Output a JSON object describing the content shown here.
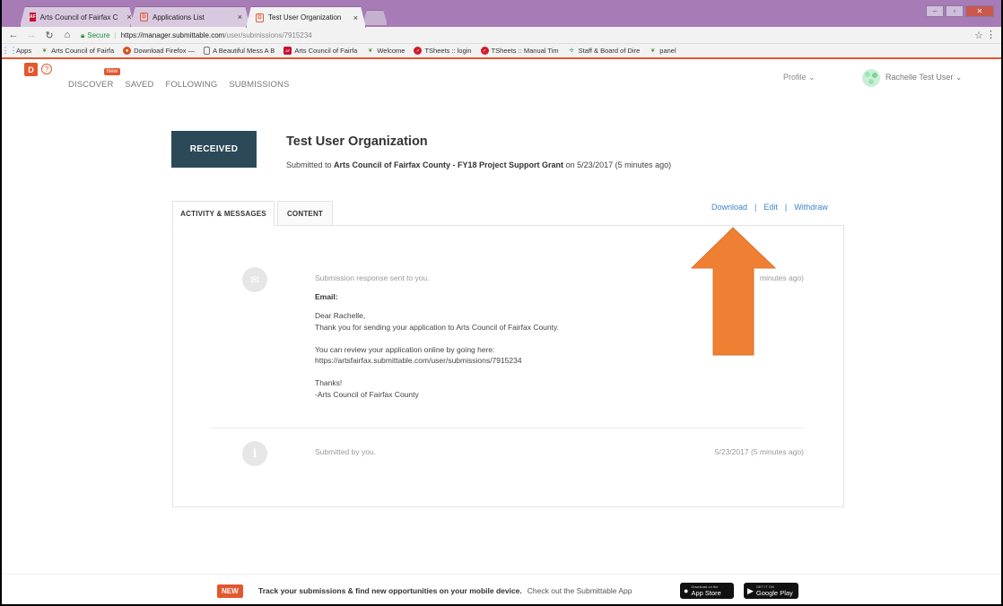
{
  "browser": {
    "tabs": [
      {
        "label": "Arts Council of Fairfax C",
        "icon": "acf-favicon",
        "close": "×"
      },
      {
        "label": "Applications List",
        "icon": "submittable-favicon",
        "close": "×"
      },
      {
        "label": "Test User Organization",
        "icon": "submittable-favicon",
        "close": "×",
        "active": true
      }
    ],
    "address": {
      "secure_label": "Secure",
      "url_host": "https://manager.submittable.com",
      "url_path": "/user/submissions/7915234"
    },
    "bookmarks": [
      {
        "label": "Apps",
        "icon": "apps-grid-icon"
      },
      {
        "label": "Arts Council of Fairfa",
        "icon": "leaf-icon"
      },
      {
        "label": "Download Firefox —",
        "icon": "firefox-icon"
      },
      {
        "label": "A Beautiful Mess A B",
        "icon": "document-icon"
      },
      {
        "label": "Arts Council of Fairfa",
        "icon": "acf-icon"
      },
      {
        "label": "Welcome",
        "icon": "leaf-icon"
      },
      {
        "label": "TSheets :: login",
        "icon": "tsheets-icon"
      },
      {
        "label": "TSheets :: Manual Tim",
        "icon": "tsheets-icon"
      },
      {
        "label": "Staff & Board of Dire",
        "icon": "staff-icon"
      },
      {
        "label": "panel",
        "icon": "leaf-icon"
      }
    ]
  },
  "header": {
    "nav": [
      "DISCOVER",
      "SAVED",
      "FOLLOWING",
      "SUBMISSIONS"
    ],
    "new_badge": "New",
    "profile_label": "Profile ⌄",
    "user_label": "Rachelle Test User ⌄"
  },
  "submission": {
    "status": "RECEIVED",
    "title": "Test User Organization",
    "submitted_prefix": "Submitted to ",
    "submitted_target": "Arts Council of Fairfax County - FY18 Project Support Grant",
    "submitted_suffix": " on 5/23/2017 (5 minutes ago)"
  },
  "tabs": {
    "activity": "ACTIVITY & MESSAGES",
    "content": "CONTENT"
  },
  "actions": {
    "download": "Download",
    "edit": "Edit",
    "withdraw": "Withdraw",
    "separator": "|"
  },
  "feed": [
    {
      "icon": "envelope-icon",
      "meta": "Submission response sent to you.",
      "time": "minutes ago)",
      "email_label": "Email:",
      "body": [
        "Dear Rachelle,",
        "Thank you for sending your application to Arts Council of Fairfax County.",
        "You can review your application online by going here:",
        "https://artsfairfax.submittable.com/user/submissions/7915234",
        "Thanks!",
        "-Arts Council of Fairfax County"
      ]
    },
    {
      "icon": "info-icon",
      "meta": "Submitted by you.",
      "time": "5/23/2017 (5 minutes ago)"
    }
  ],
  "footer": {
    "new_label": "NEW",
    "message": "Track your submissions & find new opportunities on your mobile device.",
    "app_prompt": "Check out the Submittable App",
    "app_store": {
      "small": "Download on the",
      "label": "App Store"
    },
    "google_play": {
      "small": "GET IT ON",
      "label": "Google Play"
    }
  },
  "colors": {
    "brand_orange": "#e4572e",
    "status_dark": "#2c4957",
    "link_blue": "#3a87c7",
    "browser_purple": "#a77bb5",
    "arrow_orange": "#ee7f33"
  }
}
